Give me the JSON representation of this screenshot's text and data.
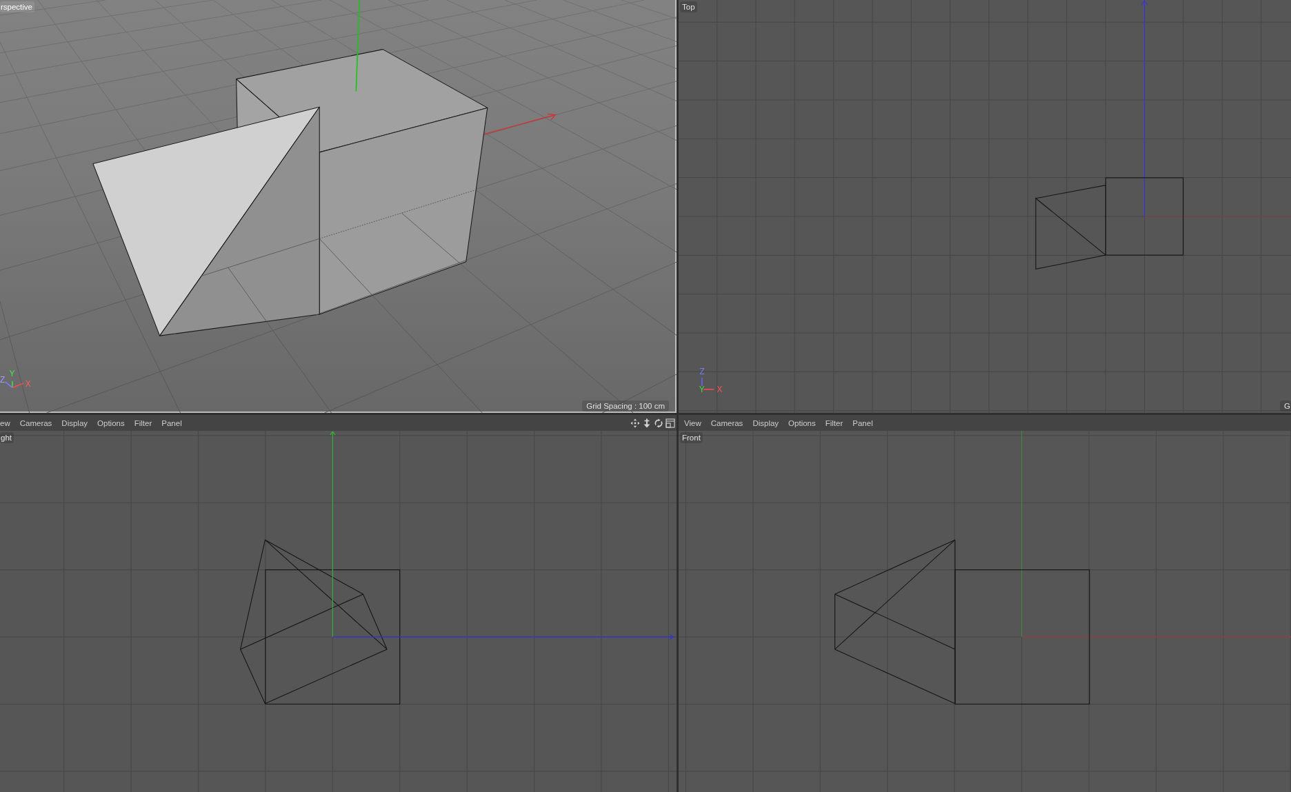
{
  "viewports": [
    {
      "kind": "perspective",
      "label": "rspective",
      "selected": true,
      "axes": {
        "x": "X",
        "y": "Y",
        "z": "Z"
      },
      "grid_spacing": "Grid Spacing : 100 cm"
    },
    {
      "kind": "top",
      "label": "Top",
      "selected": false,
      "axes": {
        "x": "X",
        "y": "Y",
        "z": "Z"
      },
      "grid_spacing": "G"
    },
    {
      "kind": "right",
      "label": "ght",
      "selected": false,
      "menu": [
        "ew",
        "Cameras",
        "Display",
        "Options",
        "Filter",
        "Panel"
      ],
      "nav_icons": true
    },
    {
      "kind": "front",
      "label": "Front",
      "selected": false,
      "menu": [
        "View",
        "Cameras",
        "Display",
        "Options",
        "Filter",
        "Panel"
      ]
    }
  ]
}
